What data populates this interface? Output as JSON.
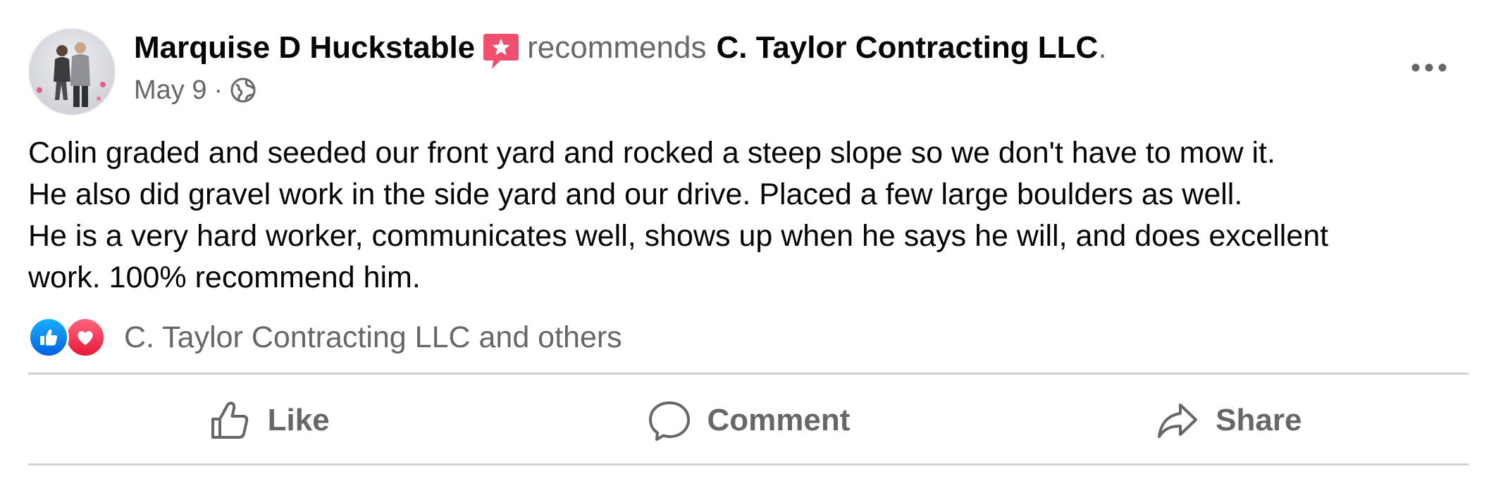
{
  "post": {
    "author": "Marquise D Huckstable",
    "recommends_text": "recommends",
    "page_name": "C. Taylor Contracting LLC",
    "trailing": ".",
    "date": "May 9",
    "separator": "·",
    "privacy_icon": "globe-icon",
    "recommend_icon": "recommendation-badge-icon",
    "more_icon": "more-options-icon"
  },
  "body": {
    "lines": [
      "Colin graded and seeded our front yard and rocked a steep slope so we don't have to mow it.",
      "He also did gravel work in the side yard and our drive. Placed a few large boulders as well.",
      "He is a very hard worker, communicates well, shows up when he says he will, and does excellent",
      "work. 100% recommend him."
    ]
  },
  "reactions": {
    "types": [
      "like",
      "love"
    ],
    "summary": "C. Taylor Contracting LLC and others"
  },
  "actions": {
    "like": "Like",
    "comment": "Comment",
    "share": "Share"
  },
  "colors": {
    "text_primary": "#050505",
    "text_secondary": "#65676b",
    "divider": "#ced0d4",
    "like_blue": "#0866ff",
    "love_red": "#f33e58",
    "recommend_badge": "#f0506e"
  }
}
